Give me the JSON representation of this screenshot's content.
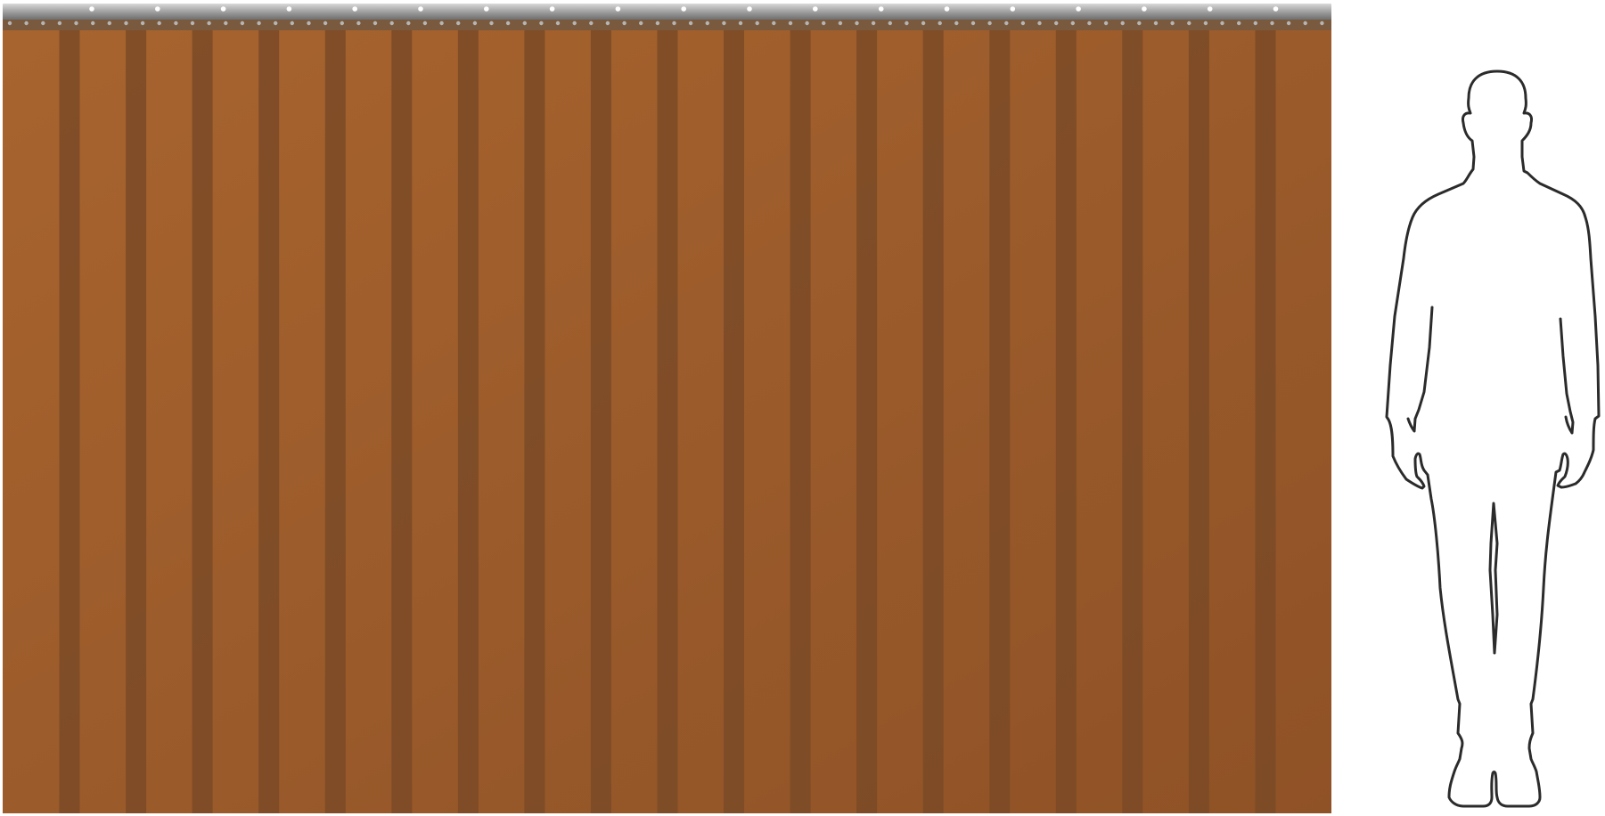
{
  "curtain": {
    "strip_count": 20,
    "overlap_count": 19,
    "rail_hole_count": 20,
    "rail_rivet_count": 80,
    "colors": {
      "rail_top": "#d9d9d9",
      "rail_mid": "#9b9b9b",
      "rail_bottom": "#6f6f6f",
      "rail_hole": "#ffffff",
      "rivet": "#b5b5b5",
      "clamp_strip": "#7a5a3e",
      "strip_light": "#a8642f",
      "strip_dark": "#8f5226",
      "overlap": "#7a4a27"
    }
  },
  "person": {
    "outline_color": "#2b2b2b",
    "fill_color": "#ffffff",
    "icon": "person-silhouette-icon"
  }
}
